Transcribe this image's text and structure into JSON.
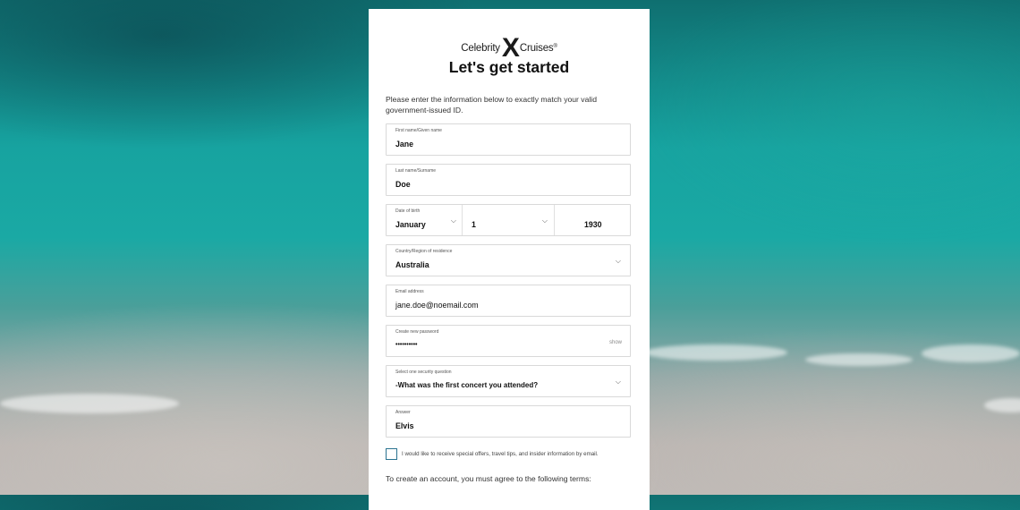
{
  "logo": {
    "left": "Celebrity",
    "x": "X",
    "right": "Cruises",
    "reg": "®"
  },
  "page_title": "Let's get started",
  "intro_text": "Please enter the information below to exactly match your valid government-issued ID.",
  "fields": {
    "first_name": {
      "label": "First name/Given name",
      "value": "Jane"
    },
    "last_name": {
      "label": "Last name/Surname",
      "value": "Doe"
    },
    "dob": {
      "label": "Date of birth",
      "month": "January",
      "day": "1",
      "year": "1930"
    },
    "country": {
      "label": "Country/Region of residence",
      "value": "Australia"
    },
    "email": {
      "label": "Email address",
      "value": "jane.doe@noemail.com"
    },
    "password": {
      "label": "Create new password",
      "value": "••••••••••",
      "show_label": "show"
    },
    "security_question": {
      "label": "Select one security question",
      "value": "-What was the first concert you attended?"
    },
    "answer": {
      "label": "Answer",
      "value": "Elvis"
    }
  },
  "offers_checkbox": {
    "label": "I would like to receive special offers, travel tips, and insider information by email.",
    "checked": false
  },
  "terms_text": "To create an account, you must agree to the following terms:",
  "icons": {
    "chevron": "chevron-down-icon"
  },
  "colors": {
    "checkbox_border": "#2a7390",
    "card_bg": "#ffffff"
  }
}
